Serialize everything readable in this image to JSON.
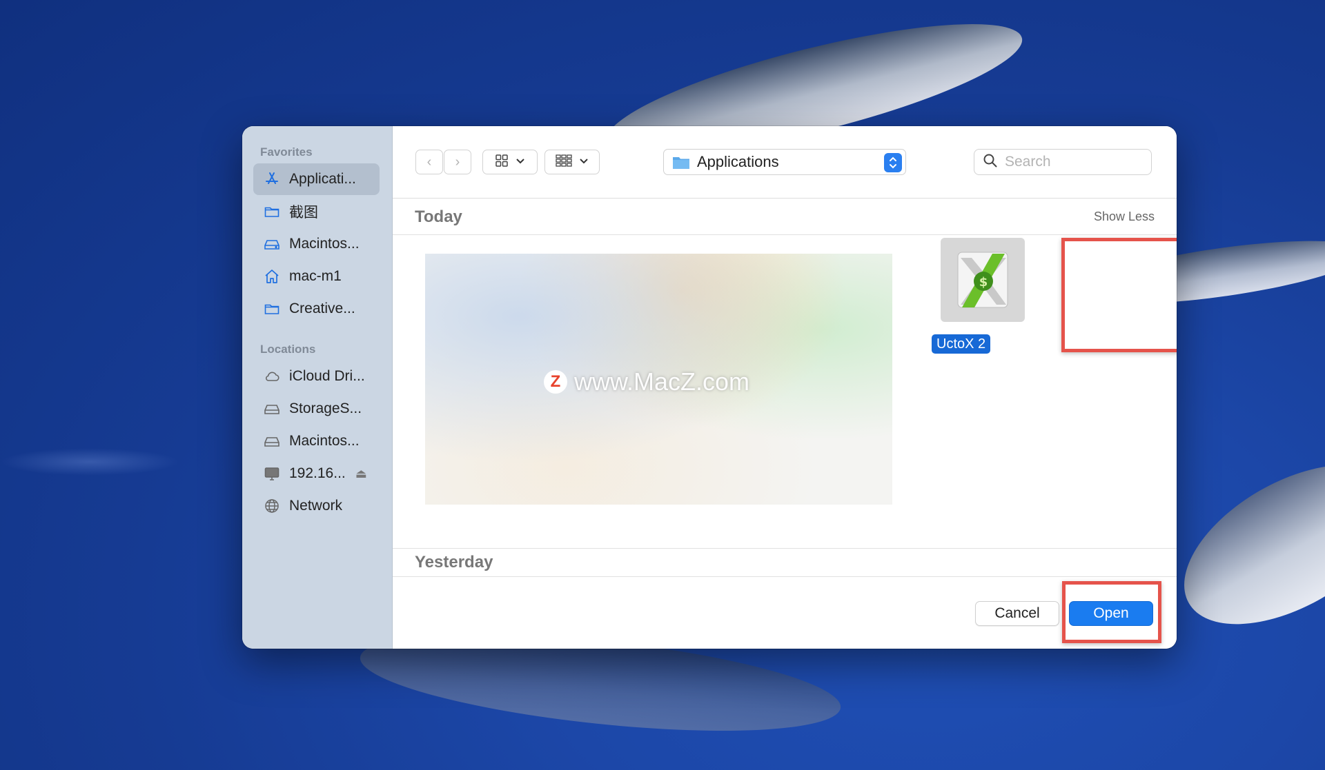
{
  "colors": {
    "accent": "#1a7cf0",
    "highlight_box": "#e5534b",
    "sidebar_bg": "#cbd6e3",
    "desktop_bg": "#1c47a8"
  },
  "sidebar": {
    "favorites_label": "Favorites",
    "favorites": [
      {
        "label": "Applicati...",
        "icon": "app-store-icon",
        "selected": true
      },
      {
        "label": "截图",
        "icon": "folder-icon"
      },
      {
        "label": "Macintos...",
        "icon": "drive-icon"
      },
      {
        "label": "mac-m1",
        "icon": "home-icon"
      },
      {
        "label": "Creative...",
        "icon": "folder-icon"
      }
    ],
    "locations_label": "Locations",
    "locations": [
      {
        "label": "iCloud Dri...",
        "icon": "cloud-icon"
      },
      {
        "label": "StorageS...",
        "icon": "drive-icon"
      },
      {
        "label": "Macintos...",
        "icon": "drive-icon"
      },
      {
        "label": "192.16...",
        "icon": "display-icon",
        "eject": "⏏"
      },
      {
        "label": "Network",
        "icon": "globe-icon"
      }
    ]
  },
  "toolbar": {
    "back_glyph": "‹",
    "forward_glyph": "›",
    "location": "Applications",
    "search_placeholder": "Search"
  },
  "content": {
    "today_label": "Today",
    "show_less_label": "Show Less",
    "watermark_text": "www.MacZ.com",
    "watermark_logo": "Z",
    "app_name": "UctoX 2",
    "yesterday_label": "Yesterday"
  },
  "footer": {
    "cancel_label": "Cancel",
    "open_label": "Open"
  }
}
